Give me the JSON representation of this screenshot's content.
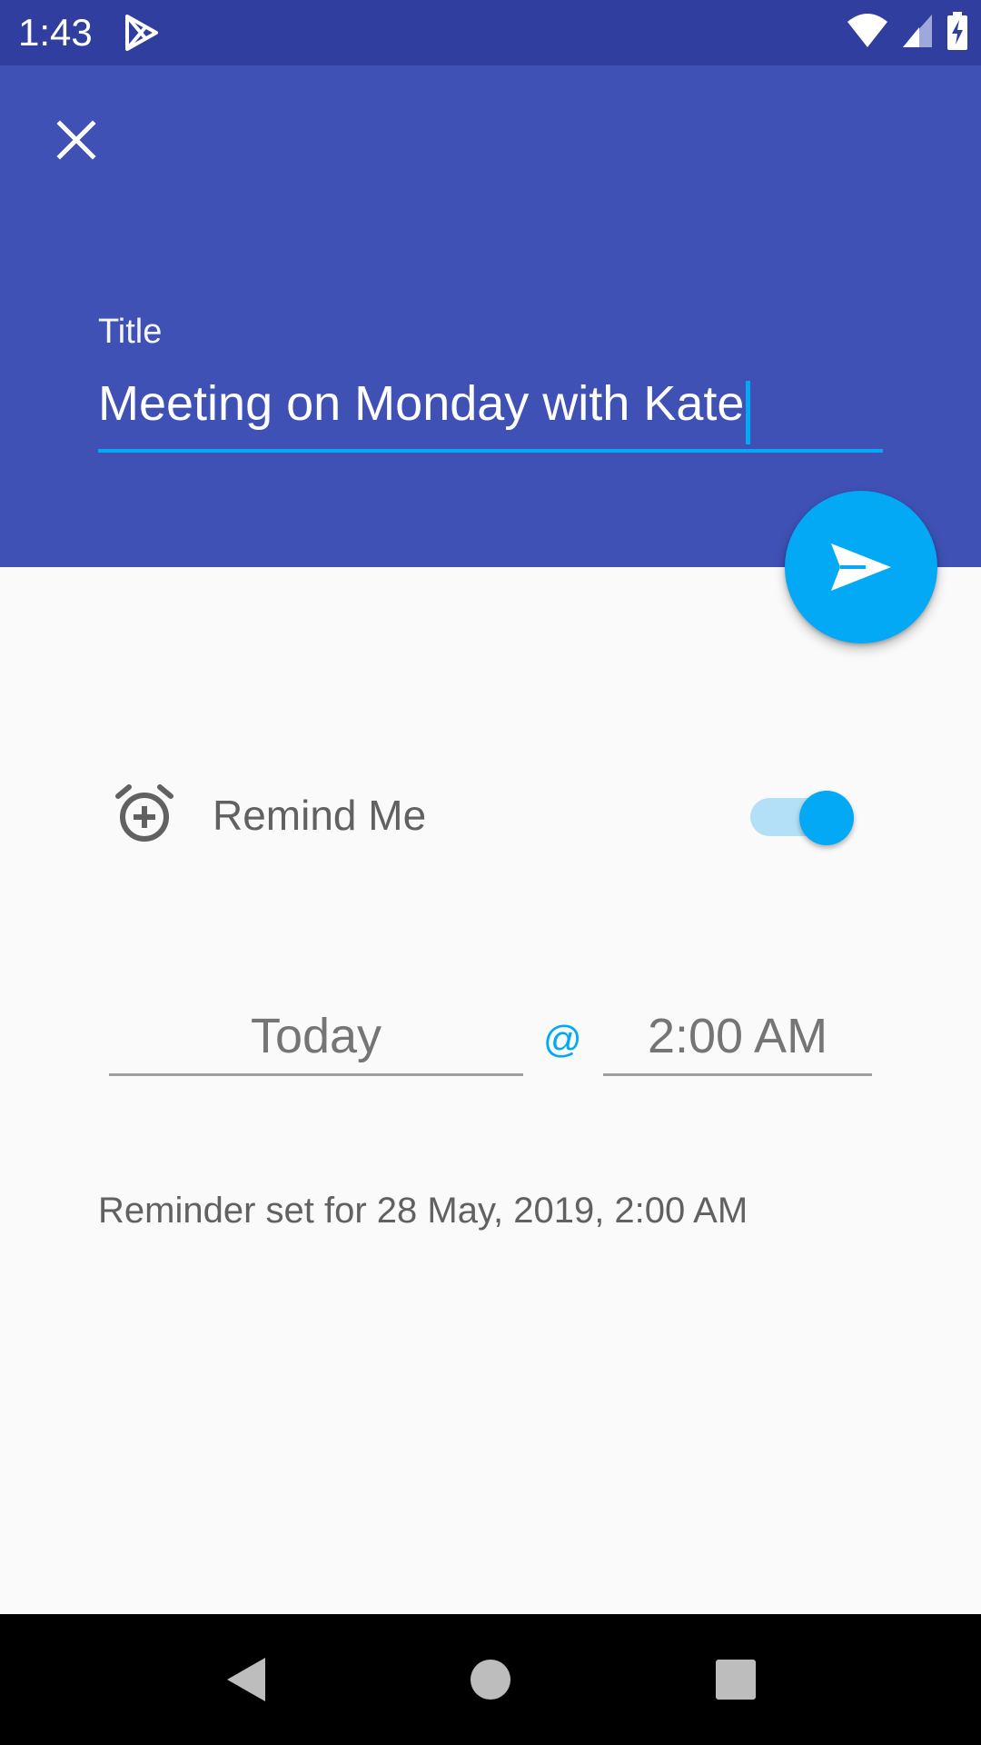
{
  "status_bar": {
    "time": "1:43",
    "icons": [
      "play-store-icon",
      "wifi-icon",
      "signal-icon",
      "battery-charging-icon"
    ]
  },
  "header": {
    "close_icon": "close-icon",
    "title_label": "Title",
    "title_value": "Meeting on Monday with Kate"
  },
  "fab": {
    "icon": "send-icon"
  },
  "remind": {
    "icon": "alarm-add-icon",
    "label": "Remind Me",
    "enabled": true
  },
  "schedule": {
    "date": "Today",
    "separator": "@",
    "time": "2:00 AM"
  },
  "reminder_summary": "Reminder set for 28 May, 2019, 2:00 AM",
  "nav_bar": {
    "icons": [
      "back-icon",
      "home-icon",
      "recents-icon"
    ]
  },
  "colors": {
    "primary": "#3f51b5",
    "primary_dark": "#303f9f",
    "accent": "#03a9f4",
    "background": "#fafafa"
  }
}
